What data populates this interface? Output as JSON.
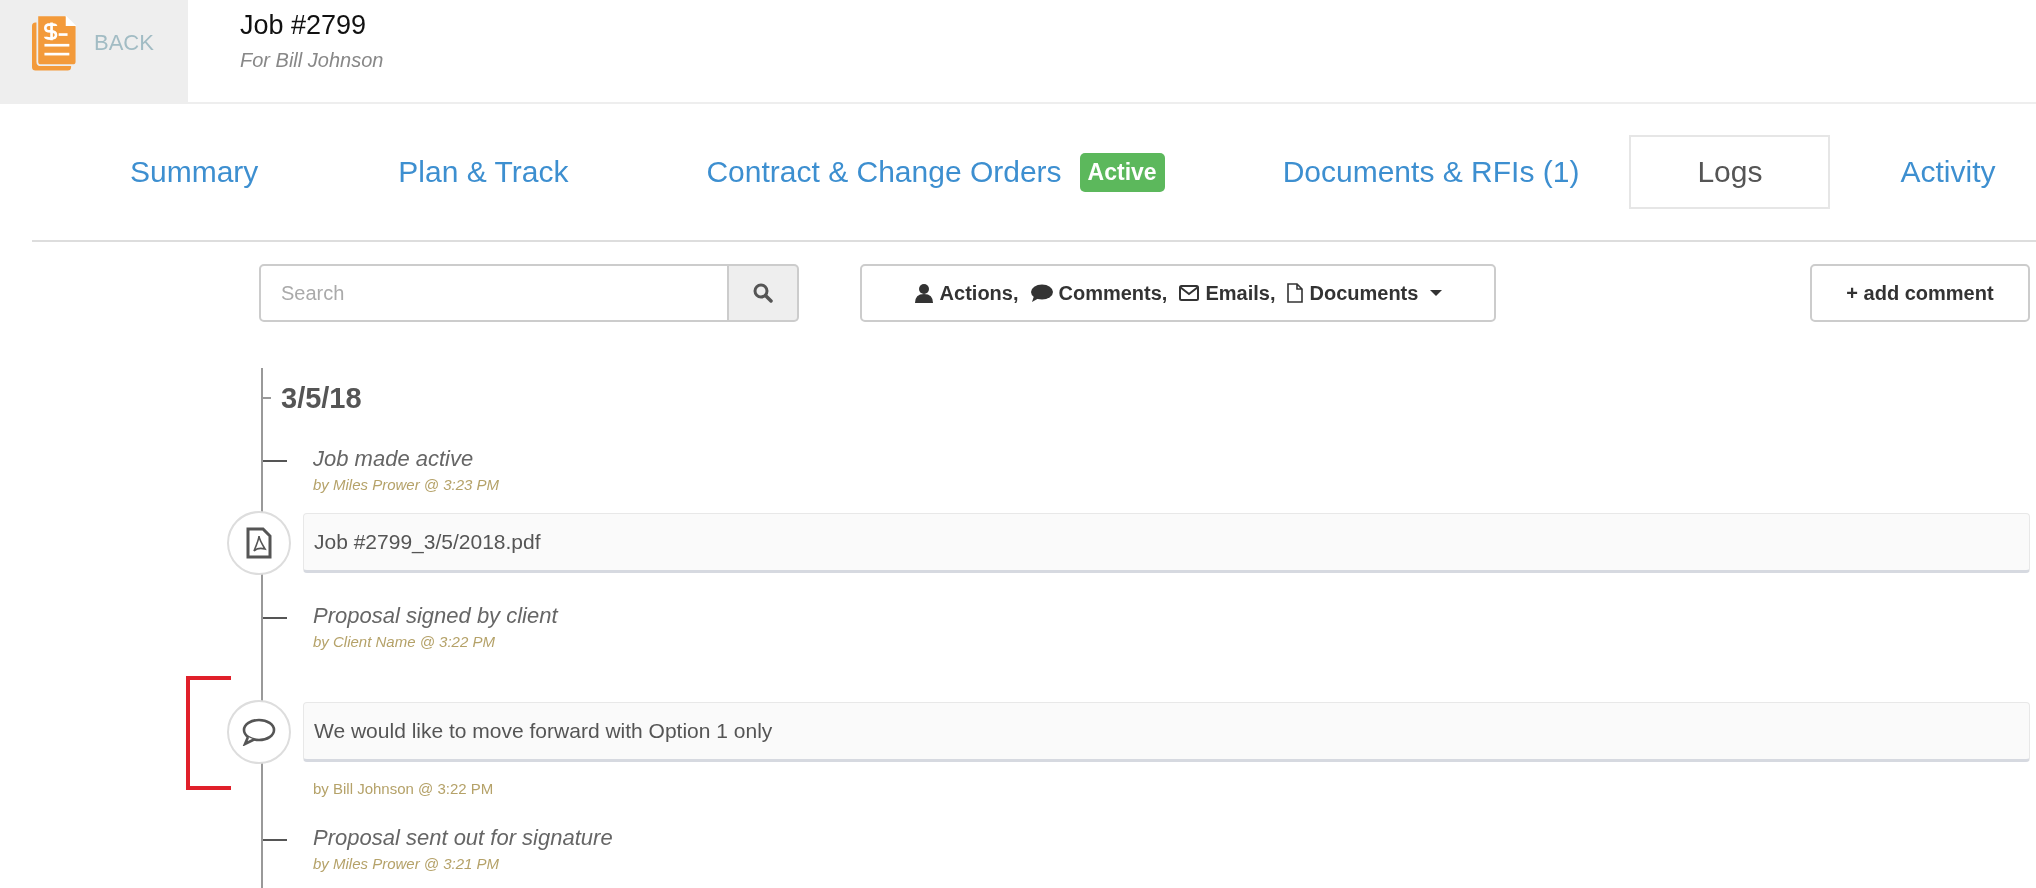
{
  "header": {
    "back_label": "BACK",
    "title": "Job #2799",
    "subtitle": "For Bill Johnson"
  },
  "tabs": [
    {
      "label": "Summary",
      "selected": false
    },
    {
      "label": "Plan & Track",
      "selected": false
    },
    {
      "label": "Contract & Change Orders",
      "selected": false,
      "badge": "Active"
    },
    {
      "label": "Documents & RFIs (1)",
      "selected": false
    },
    {
      "label": "Logs",
      "selected": true
    },
    {
      "label": "Activity",
      "selected": false
    }
  ],
  "search": {
    "placeholder": "Search"
  },
  "filter": {
    "items": [
      {
        "kind": "person",
        "label": "Actions,"
      },
      {
        "kind": "comment",
        "label": "Comments,"
      },
      {
        "kind": "email",
        "label": "Emails,"
      },
      {
        "kind": "document",
        "label": "Documents"
      }
    ]
  },
  "add_button": "+ add comment",
  "timeline": {
    "date": "3/5/18",
    "entries": [
      {
        "kind": "action",
        "title": "Job made active",
        "by": "by Miles Prower @ 3:23 PM"
      },
      {
        "kind": "document",
        "text": "Job #2799_3/5/2018.pdf"
      },
      {
        "kind": "action",
        "title": "Proposal signed by client",
        "by": "by Client Name @ 3:22 PM"
      },
      {
        "kind": "comment",
        "text": "We would like to move forward with Option 1 only",
        "by": "by Bill Johnson @ 3:22 PM",
        "highlighted": true
      },
      {
        "kind": "action",
        "title": "Proposal sent out for signature",
        "by": "by Miles Prower @ 3:21 PM"
      }
    ]
  }
}
